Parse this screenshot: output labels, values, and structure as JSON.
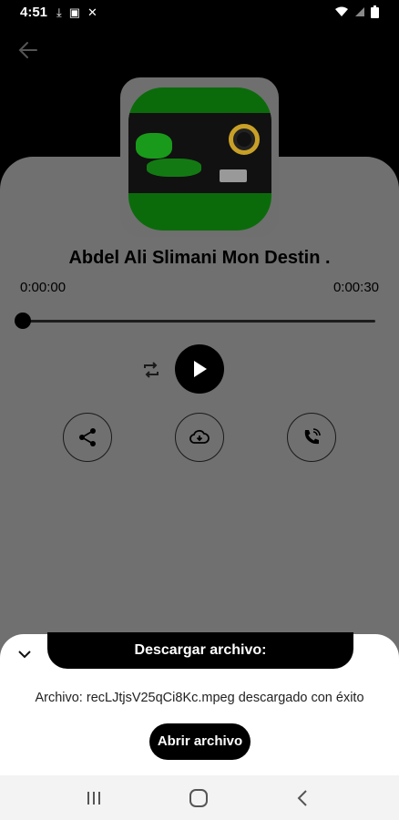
{
  "status_bar": {
    "time": "4:51",
    "left_icons": [
      "download-icon",
      "image-icon",
      "missed-call-icon"
    ],
    "right_icons": [
      "wifi-icon",
      "signal-icon",
      "battery-icon"
    ]
  },
  "player": {
    "track_title": "Abdel Ali Slimani   Mon Destin .",
    "elapsed": "0:00:00",
    "duration": "0:00:30",
    "progress": 0
  },
  "controls": {
    "repeat": "repeat-icon",
    "play": "play-icon",
    "share": "share-icon",
    "download": "cloud-download-icon",
    "call": "phone-call-icon"
  },
  "download_sheet": {
    "title": "Descargar archivo:",
    "message": "Archivo: recLJtjsV25qCi8Kc.mpeg descargado con éxito",
    "open_button_label": "Abrir archivo"
  },
  "nav_bar": {
    "items": [
      "recent-apps-icon",
      "home-icon",
      "back-icon"
    ]
  },
  "colors": {
    "overlay_gray": "#707070",
    "sheet_bg": "#ffffff",
    "accent_black": "#000000",
    "art_green": "#0b6b0b"
  }
}
